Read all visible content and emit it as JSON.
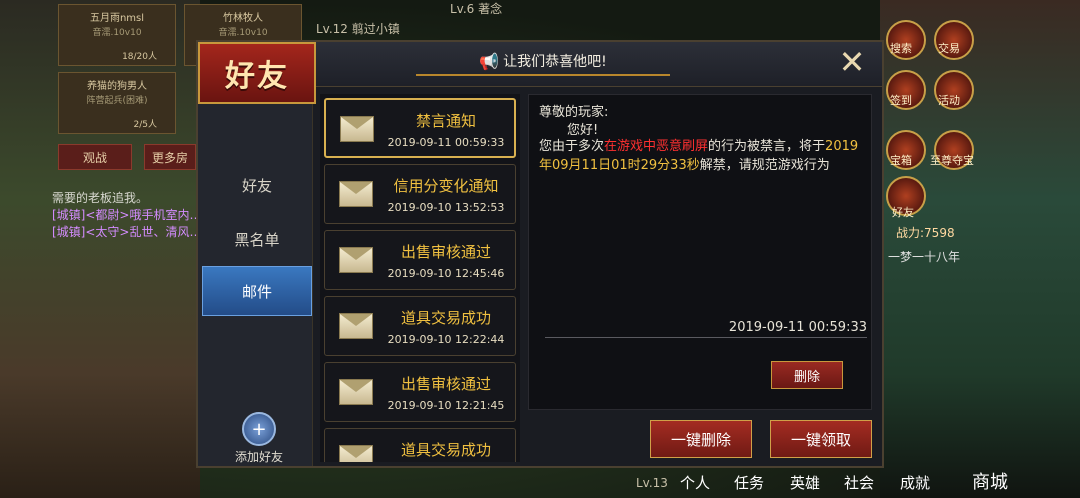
{
  "background": {
    "rooms": [
      {
        "name": "五月雨nmsl",
        "owner": "音濡.10v10",
        "count": "18/20人"
      },
      {
        "name": "竹林牧人",
        "owner": "音濡.10v10",
        "count": ""
      },
      {
        "name": "养猫的狗男人",
        "owner": "阵营起兵(困难)",
        "count": "2/5人"
      },
      {
        "name": "",
        "owner": "",
        "count": ""
      }
    ],
    "watch_label": "观战",
    "more_rooms_label": "更多房",
    "chat": [
      "需要的老板追我。",
      "[城镇]<都尉>哦手机室内…",
      "[城镇]<太守>乱世、清风…"
    ],
    "top_text": "Lv.12 翦过小镇",
    "top_text2": "Lv.6 著念",
    "right_icons": [
      "搜索",
      "交易",
      "签到",
      "活动",
      "宝箱",
      "至尊夺宝",
      "好友"
    ],
    "power": "战力:7598",
    "right_name": "一梦一十八年",
    "bottom_nav": [
      "Lv.13",
      "个人",
      "任务",
      "英雄",
      "社会",
      "成就",
      "商城"
    ]
  },
  "dialog": {
    "title": "好友",
    "banner": "让我们恭喜他吧!",
    "close_icon": "close-icon",
    "nav": [
      "好友",
      "黑名单",
      "邮件"
    ],
    "active_nav": "邮件",
    "add_friend": "添加好友"
  },
  "mails": [
    {
      "title": "禁言通知",
      "date": "2019-09-11 00:59:33"
    },
    {
      "title": "信用分变化通知",
      "date": "2019-09-10 13:52:53"
    },
    {
      "title": "出售审核通过",
      "date": "2019-09-10 12:45:46"
    },
    {
      "title": "道具交易成功",
      "date": "2019-09-10 12:22:44"
    },
    {
      "title": "出售审核通过",
      "date": "2019-09-10 12:21:45"
    },
    {
      "title": "道具交易成功",
      "date": ""
    }
  ],
  "message": {
    "greeting": "尊敬的玩家:",
    "hello": "您好!",
    "body_1": "您由于多次",
    "body_red": "在游戏中恶意刷屏",
    "body_2": "的行为被禁言，将于",
    "body_yel": "2019年09月11日01时29分33秒",
    "body_3": "解禁，请规范游戏行为",
    "sent_date": "2019-09-11 00:59:33",
    "delete_label": "删除"
  },
  "actions": {
    "delete_all": "一键删除",
    "claim_all": "一键领取"
  }
}
